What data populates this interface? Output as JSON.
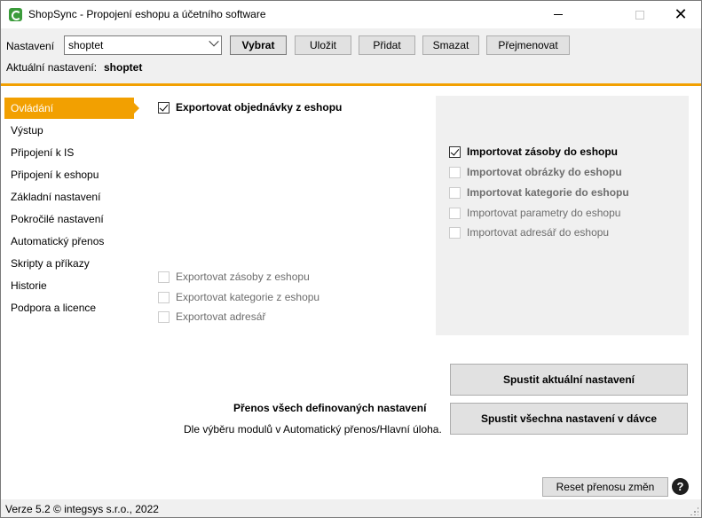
{
  "window": {
    "title": "ShopSync - Propojení eshopu a účetního software",
    "close_glyph": "✕"
  },
  "toolbar": {
    "settings_label": "Nastavení",
    "settings_value": "shoptet",
    "select_label": "Vybrat",
    "save_label": "Uložit",
    "add_label": "Přidat",
    "delete_label": "Smazat",
    "rename_label": "Přejmenovat",
    "current_label": "Aktuální nastavení:",
    "current_value": "shoptet"
  },
  "sidebar": {
    "items": [
      {
        "label": "Ovládání",
        "active": true
      },
      {
        "label": "Výstup"
      },
      {
        "label": "Připojení k IS"
      },
      {
        "label": "Připojení k eshopu"
      },
      {
        "label": "Základní nastavení"
      },
      {
        "label": "Pokročilé nastavení"
      },
      {
        "label": "Automatický přenos"
      },
      {
        "label": "Skripty a příkazy"
      },
      {
        "label": "Historie"
      },
      {
        "label": "Podpora a licence"
      }
    ]
  },
  "export": {
    "orders": {
      "label": "Exportovat objednávky z eshopu",
      "checked": true
    },
    "stock": {
      "label": "Exportovat zásoby z eshopu",
      "checked": false
    },
    "categories": {
      "label": "Exportovat kategorie z eshopu",
      "checked": false
    },
    "addressbook": {
      "label": "Exportovat adresář",
      "checked": false
    }
  },
  "import": {
    "stock": {
      "label": "Importovat zásoby do eshopu",
      "checked": true
    },
    "images": {
      "label": "Importovat obrázky do eshopu",
      "checked": false
    },
    "categories": {
      "label": "Importovat kategorie do eshopu",
      "checked": false
    },
    "parameters": {
      "label": "Importovat parametry do eshopu",
      "checked": false
    },
    "addressbook": {
      "label": "Importovat adresář do eshopu",
      "checked": false
    }
  },
  "actions": {
    "run_current_label": "Spustit aktuální nastavení",
    "transfer_title": "Přenos všech definovaných nastavení",
    "transfer_desc": "Dle výběru modulů v Automatický přenos/Hlavní úloha.",
    "run_all_label": "Spustit všechna nastavení v dávce",
    "reset_label": "Reset přenosu změn",
    "help_glyph": "?"
  },
  "status": {
    "text": "Verze 5.2  © integsys s.r.o., 2022"
  },
  "colors": {
    "accent": "#f2a001",
    "panel_bg": "#f0f0f0"
  }
}
